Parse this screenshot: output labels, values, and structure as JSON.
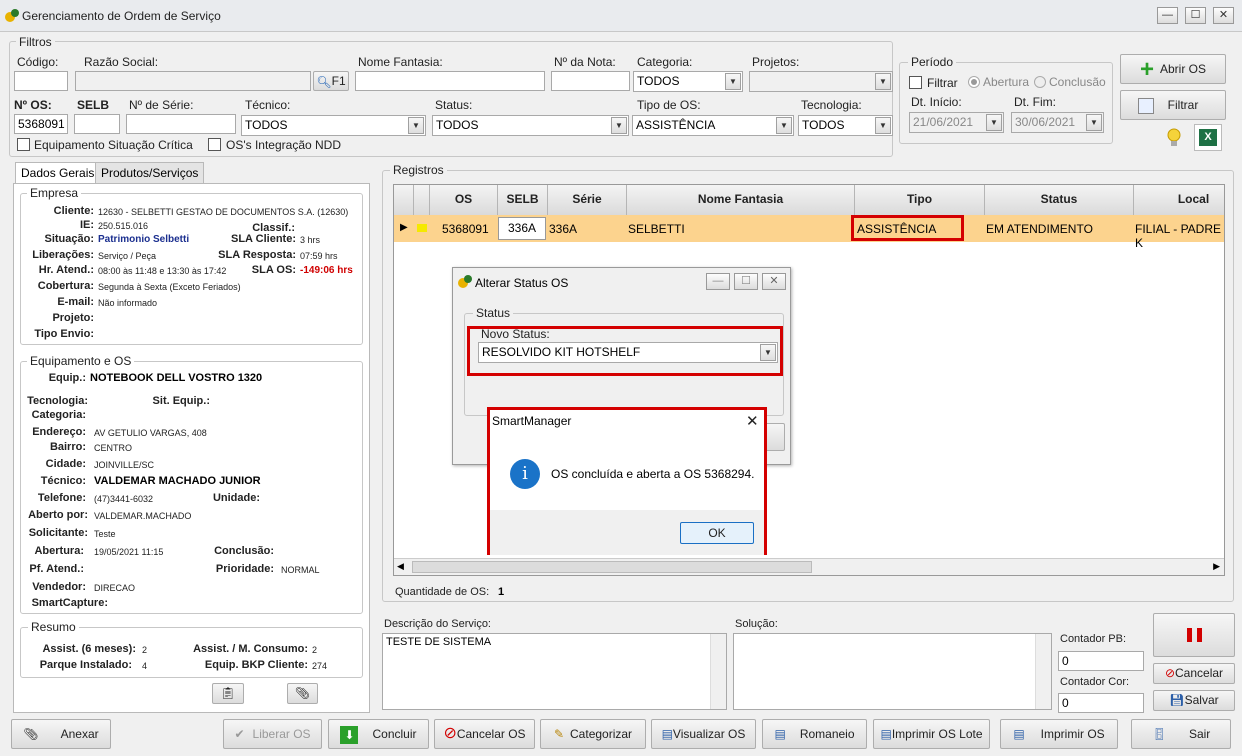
{
  "window": {
    "title": "Gerenciamento de Ordem de Serviço",
    "min": "—",
    "max": "☐",
    "close": "✕"
  },
  "filtros": {
    "legend": "Filtros",
    "codigo_label": "Código:",
    "razao_label": "Razão Social:",
    "f1": "F1",
    "fantasia_label": "Nome Fantasia:",
    "nota_label": "Nº da Nota:",
    "categoria_label": "Categoria:",
    "categoria_value": "TODOS",
    "projetos_label": "Projetos:",
    "os_label": "Nº OS:",
    "os_value": "5368091",
    "selb_label": "SELB",
    "serie_label": "Nº de Série:",
    "tecnico_label": "Técnico:",
    "tecnico_value": "TODOS",
    "status_label": "Status:",
    "status_value": "TODOS",
    "tipo_label": "Tipo de OS:",
    "tipo_value": "ASSISTÊNCIA",
    "tecnologia_label": "Tecnologia:",
    "tecnologia_value": "TODOS",
    "eq_critica": "Equipamento Situação Crítica",
    "os_ndd": "OS's Integração NDD"
  },
  "periodo": {
    "legend": "Período",
    "filtrar": "Filtrar",
    "abertura": "Abertura",
    "conclusao": "Conclusão",
    "dt_inicio_label": "Dt. Início:",
    "dt_inicio": "21/06/2021",
    "dt_fim_label": "Dt. Fim:",
    "dt_fim": "30/06/2021"
  },
  "actions": {
    "abrir_os": "Abrir OS",
    "filtrar": "Filtrar"
  },
  "tabs": [
    "Dados Gerais",
    "Produtos/Serviços"
  ],
  "empresa": {
    "legend": "Empresa",
    "rows": [
      {
        "label": "Cliente:",
        "value": "12630 - SELBETTI GESTAO DE DOCUMENTOS S.A. (12630)"
      },
      {
        "label": "IE:",
        "value": "250.515.016"
      },
      {
        "label": "Situação:",
        "value": "Patrimonio Selbetti"
      },
      {
        "label": "Liberações:",
        "value": "Serviço / Peça"
      },
      {
        "label": "Hr. Atend.:",
        "value": "08:00 às 11:48 e 13:30 às 17:42"
      },
      {
        "label": "Cobertura:",
        "value": "Segunda à Sexta (Exceto Feriados)"
      },
      {
        "label": "E-mail:",
        "value": "Não informado"
      },
      {
        "label": "Projeto:",
        "value": ""
      },
      {
        "label": "Tipo Envio:",
        "value": ""
      }
    ],
    "classif_label": "Classif.:",
    "sla_cliente_label": "SLA Cliente:",
    "sla_cliente": "3 hrs",
    "sla_resposta_label": "SLA Resposta:",
    "sla_resposta": "07:59 hrs",
    "sla_os_label": "SLA OS:",
    "sla_os": "-149:06 hrs"
  },
  "equipamento": {
    "legend": "Equipamento e OS",
    "equip_label": "Equip.:",
    "equip": "NOTEBOOK DELL VOSTRO 1320",
    "tecnologia_label": "Tecnologia:",
    "sit_label": "Sit. Equip.:",
    "categoria_label": "Categoria:",
    "endereco_label": "Endereço:",
    "endereco": "AV GETULIO VARGAS, 408",
    "bairro_label": "Bairro:",
    "bairro": "CENTRO",
    "cidade_label": "Cidade:",
    "cidade": "JOINVILLE/SC",
    "tecnico_label": "Técnico:",
    "tecnico": "VALDEMAR MACHADO JUNIOR",
    "telefone_label": "Telefone:",
    "telefone": "(47)3441-6032",
    "unidade_label": "Unidade:",
    "aberto_label": "Aberto por:",
    "aberto": "VALDEMAR.MACHADO",
    "solicitante_label": "Solicitante:",
    "solicitante": "Teste",
    "abertura_label": "Abertura:",
    "abertura": "19/05/2021 11:15",
    "conclusao_label": "Conclusão:",
    "pf_label": "Pf. Atend.:",
    "prioridade_label": "Prioridade:",
    "prioridade": "NORMAL",
    "vendedor_label": "Vendedor:",
    "vendedor": "DIRECAO",
    "smartcapture_label": "SmartCapture:"
  },
  "resumo": {
    "legend": "Resumo",
    "assist_label": "Assist. (6 meses):",
    "assist": "2",
    "assist_m_label": "Assist. / M. Consumo:",
    "assist_m": "2",
    "parque_label": "Parque Instalado:",
    "parque": "4",
    "bkp_label": "Equip. BKP Cliente:",
    "bkp": "274"
  },
  "registros": {
    "legend": "Registros",
    "columns": [
      "OS",
      "SELB",
      "Série",
      "Nome Fantasia",
      "Tipo",
      "Status",
      "Local"
    ],
    "row": {
      "os": "5368091",
      "selb": "336A",
      "serie": "336A",
      "fantasia": "SELBETTI",
      "tipo": "ASSISTÊNCIA",
      "status": "EM ATENDIMENTO",
      "local": "FILIAL - PADRE K"
    },
    "qtd_label": "Quantidade de OS:",
    "qtd": "1"
  },
  "alterar": {
    "title": "Alterar Status OS",
    "group": "Status",
    "novo_label": "Novo Status:",
    "novo_value": "RESOLVIDO KIT HOTSHELF"
  },
  "msgbox": {
    "title": "SmartManager",
    "close": "✕",
    "text": "OS concluída e aberta a OS 5368294.",
    "ok": "OK"
  },
  "bottom": {
    "descricao_label": "Descrição do Serviço:",
    "descricao": "TESTE DE SISTEMA",
    "solucao_label": "Solução:",
    "contador_pb_label": "Contador PB:",
    "contador_pb": "0",
    "contador_cor_label": "Contador Cor:",
    "contador_cor": "0",
    "cancelar": "Cancelar",
    "salvar": "Salvar"
  },
  "toolbar": [
    "Anexar",
    "Liberar OS",
    "Concluir",
    "Cancelar OS",
    "Categorizar",
    "Visualizar OS",
    "Romaneio",
    "Imprimir OS Lote",
    "Imprimir OS",
    "Sair"
  ],
  "colors": {
    "selected_row": "#fcd38e",
    "highlight": "#d40000",
    "accent": "#1a73c8"
  }
}
